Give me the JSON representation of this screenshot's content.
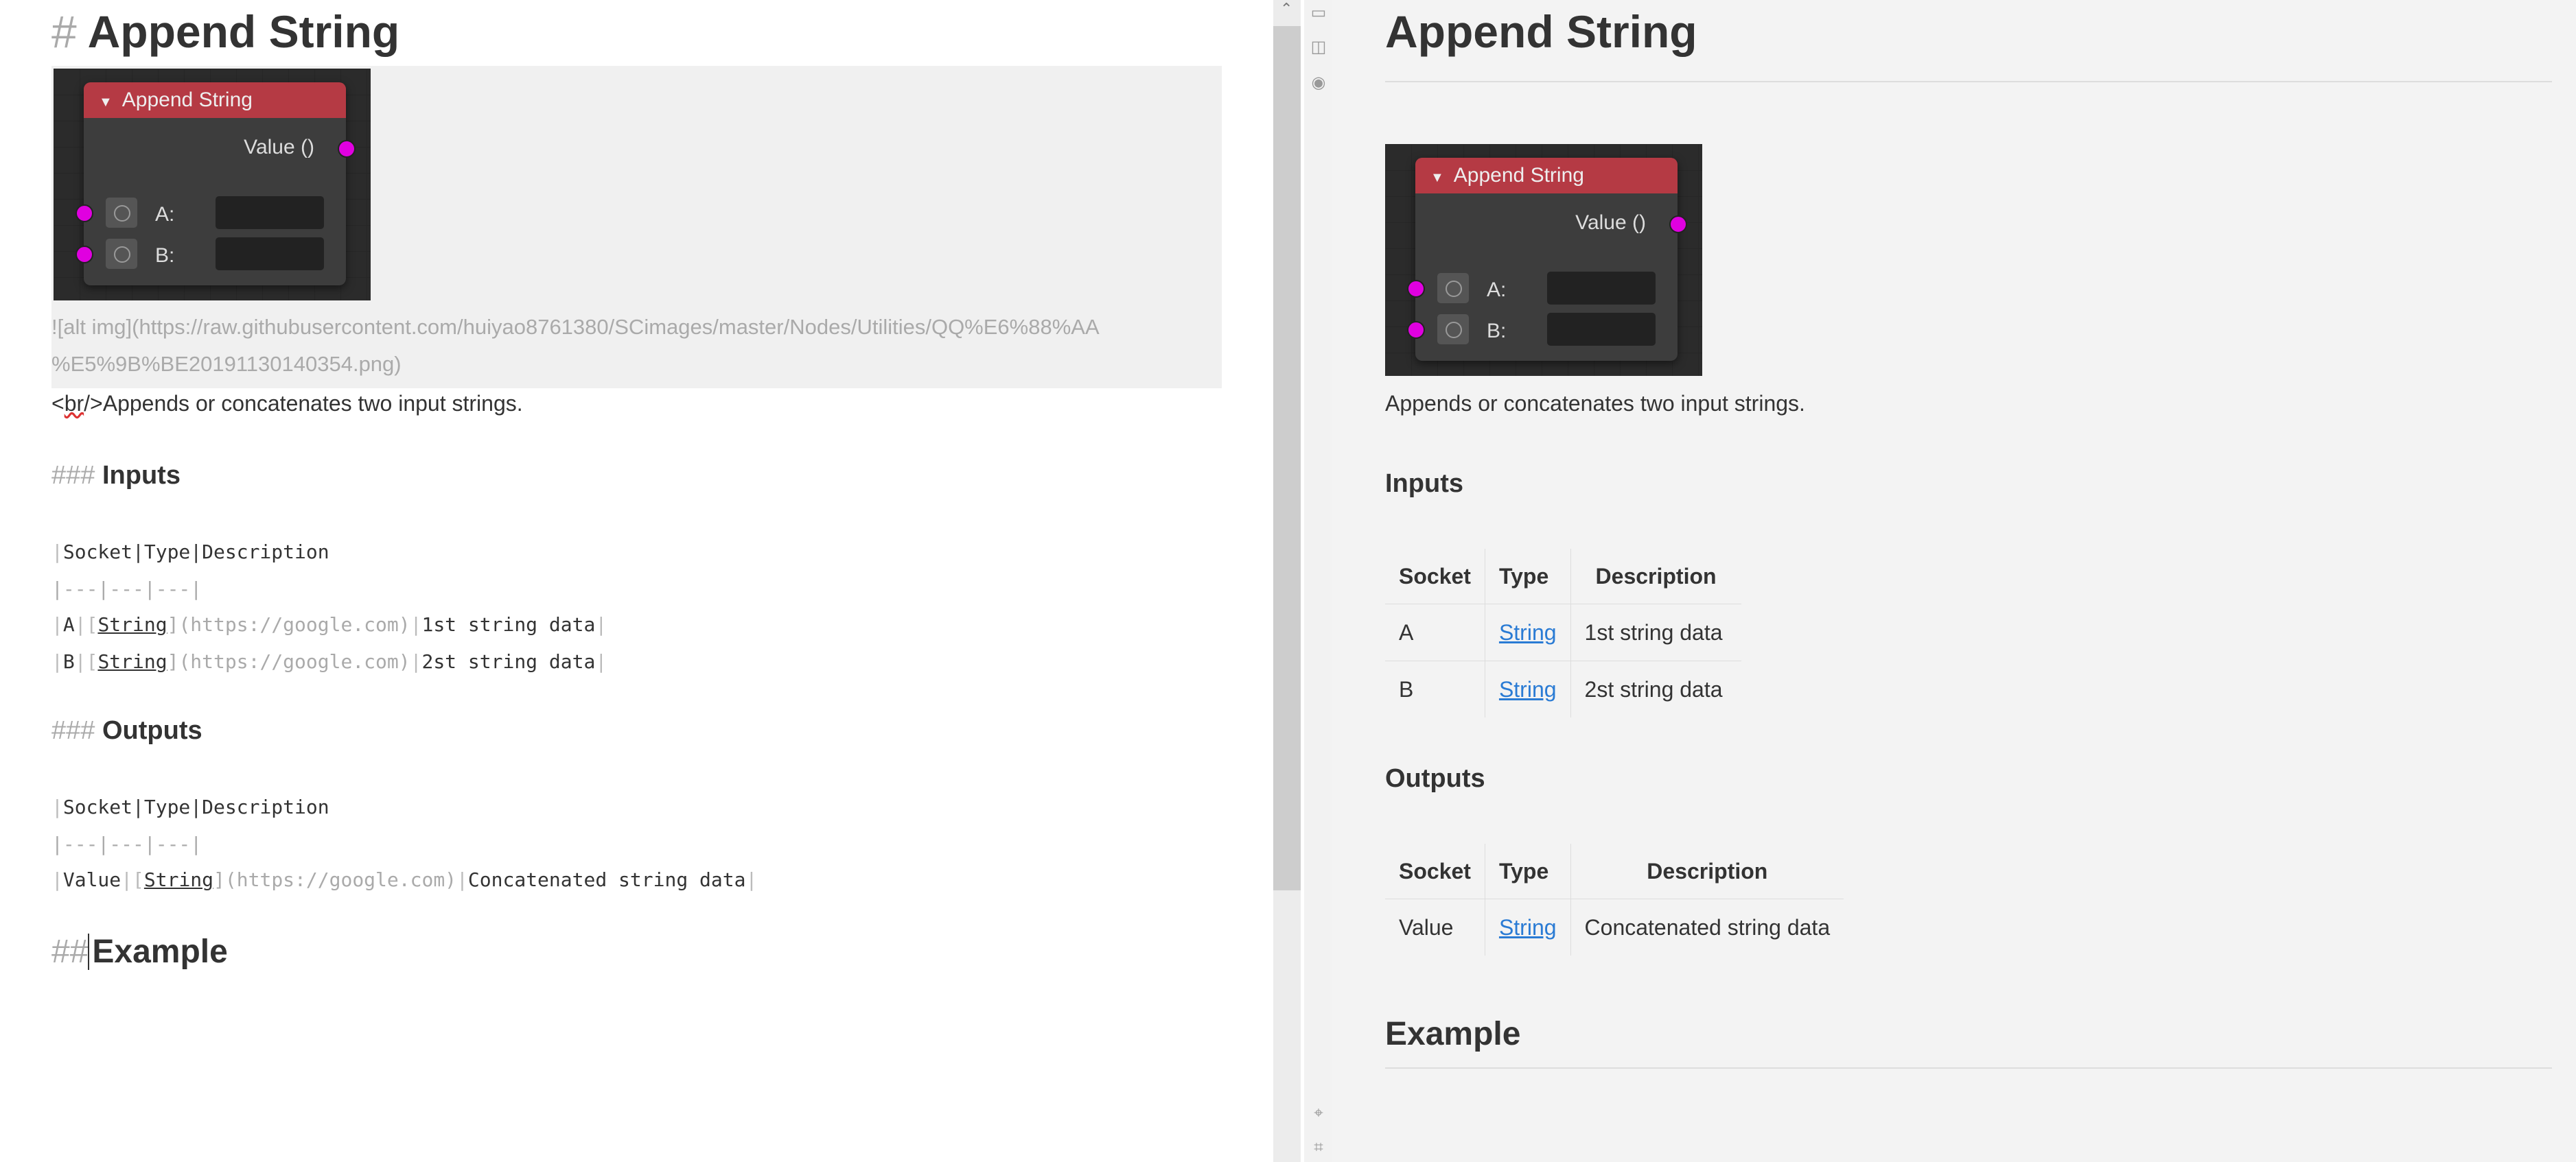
{
  "editor": {
    "title_hash": "#",
    "title": "Append String",
    "image_src_line1": "![alt img](https://raw.githubusercontent.com/huiyao8761380/SCimages/master/Nodes/Utilities/QQ%E6%88%AA",
    "image_src_line2": "%E5%9B%BE20191130140354.png)",
    "desc_tag_open": "<",
    "desc_tag": "br",
    "desc_tag_close": "/>",
    "desc_text": "Appends or concatenates two input strings.",
    "inputs_hash": "###",
    "inputs_heading": "Inputs",
    "inputs_header_row": "Socket|Type|Description",
    "inputs_sep_row": "|---|---|---|",
    "inputs_rows": [
      {
        "socket": "A",
        "type": "String",
        "url": "(https://google.com)",
        "desc": "1st string data"
      },
      {
        "socket": "B",
        "type": "String",
        "url": "(https://google.com)",
        "desc": "2st string data"
      }
    ],
    "outputs_hash": "###",
    "outputs_heading": "Outputs",
    "outputs_header_row": "Socket|Type|Description",
    "outputs_sep_row": "|---|---|---|",
    "outputs_rows": [
      {
        "socket": "Value",
        "type": "String",
        "url": "(https://google.com)",
        "desc": "Concatenated string data"
      }
    ],
    "example_hash": "##",
    "example_heading": "Example"
  },
  "node": {
    "title": "Append String",
    "collapse_glyph": "▼",
    "output_label": "Value ()",
    "input_a": "A:",
    "input_b": "B:"
  },
  "preview": {
    "title": "Append String",
    "desc": "Appends or concatenates two input strings.",
    "inputs_heading": "Inputs",
    "outputs_heading": "Outputs",
    "example_heading": "Example",
    "col_socket": "Socket",
    "col_type": "Type",
    "col_desc": "Description",
    "inputs_rows": [
      {
        "socket": "A",
        "type": "String",
        "desc": "1st string data"
      },
      {
        "socket": "B",
        "type": "String",
        "desc": "2st string data"
      }
    ],
    "outputs_rows": [
      {
        "socket": "Value",
        "type": "String",
        "desc": "Concatenated string data"
      }
    ]
  },
  "toolbar": {
    "icons": [
      "window-icon",
      "split-view-icon",
      "eye-icon",
      "crosshair-icon",
      "fit-icon"
    ]
  },
  "colors": {
    "accent_link": "#2a7bd4",
    "node_header": "#b53a44",
    "socket": "#e000e0"
  }
}
